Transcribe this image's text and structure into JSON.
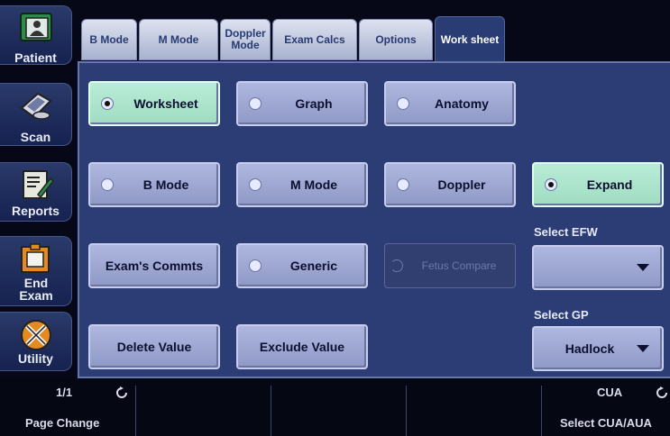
{
  "sidebar": {
    "items": [
      {
        "label": "Patient",
        "icon": "patient-icon"
      },
      {
        "label": "Scan",
        "icon": "scan-probe-icon"
      },
      {
        "label": "Reports",
        "icon": "reports-icon"
      },
      {
        "label": "End Exam",
        "icon": "end-exam-icon"
      },
      {
        "label": "Utility",
        "icon": "utility-tools-icon"
      }
    ]
  },
  "tabs": [
    {
      "label": "B Mode"
    },
    {
      "label": "M Mode"
    },
    {
      "label": "Doppler Mode"
    },
    {
      "label": "Exam Calcs"
    },
    {
      "label": "Options"
    },
    {
      "label": "Work sheet",
      "active": true
    }
  ],
  "panel": {
    "worksheet": "Worksheet",
    "graph": "Graph",
    "anatomy": "Anatomy",
    "b_mode": "B Mode",
    "m_mode": "M Mode",
    "doppler": "Doppler",
    "expand": "Expand",
    "exam_comments": "Exam's Commts",
    "generic": "Generic",
    "fetus_compare": "Fetus Compare",
    "select_efw_label": "Select EFW",
    "select_efw_value": "",
    "select_gp_label": "Select GP",
    "select_gp_value": "Hadlock",
    "delete_value": "Delete Value",
    "exclude_value": "Exclude Value"
  },
  "status": {
    "page_counter": "1/1",
    "page_change": "Page Change",
    "cua": "CUA",
    "select_cua": "Select CUA/AUA"
  },
  "colors": {
    "panel_bg": "#2b3d74",
    "button_bg": "#9ea8d6",
    "selected_button_bg": "#a9e3cb",
    "tab_bg": "#c6cde6"
  }
}
